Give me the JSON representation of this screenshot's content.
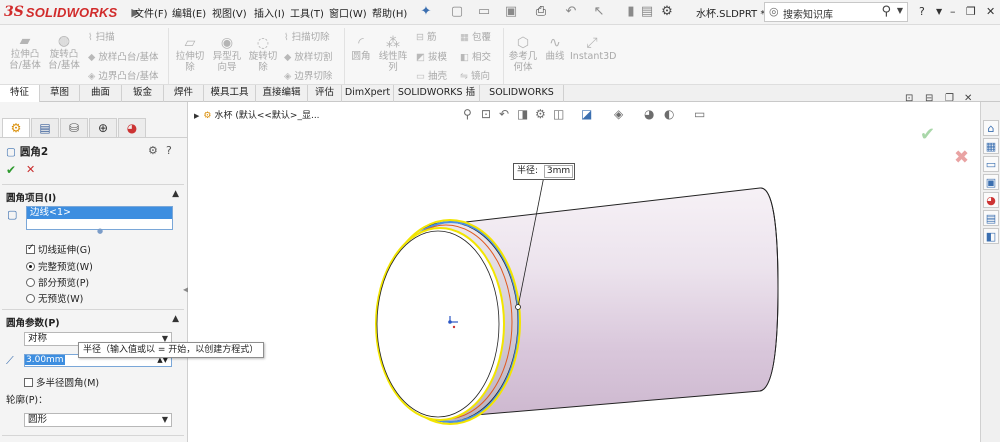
{
  "app": {
    "logo_text": "SOLIDWORKS",
    "menu": [
      "文件(F)",
      "编辑(E)",
      "视图(V)",
      "插入(I)",
      "工具(T)",
      "窗口(W)",
      "帮助(H)"
    ],
    "document_title": "水杯.SLDPRT *",
    "search_placeholder": "搜索知识库"
  },
  "ribbon": {
    "extrude_boss": [
      "拉伸凸",
      "台/基体"
    ],
    "revolve_boss": [
      "旋转凸",
      "台/基体"
    ],
    "sweep": "扫描",
    "loft": "放样凸台/基体",
    "boundary": "边界凸台/基体",
    "extrude_cut": [
      "拉伸切",
      "除"
    ],
    "hole_wizard": [
      "异型孔",
      "向导"
    ],
    "revolve_cut": [
      "旋转切",
      "除"
    ],
    "swept_cut": "扫描切除",
    "lofted_cut": "放样切割",
    "boundary_cut": "边界切除",
    "fillet": "圆角",
    "linear_pattern": [
      "线性阵",
      "列"
    ],
    "rib": "筋",
    "draft": "拔模",
    "shell": "抽壳",
    "wrap": "包覆",
    "intersect": "相交",
    "mirror": "镜向",
    "reference_geometry": [
      "参考几",
      "何体"
    ],
    "curves": "曲线",
    "instant3d": "Instant3D"
  },
  "tabs": [
    "特征",
    "草图",
    "曲面",
    "钣金",
    "焊件",
    "模具工具",
    "直接编辑",
    "评估",
    "DimXpert",
    "SOLIDWORKS 插件",
    "SOLIDWORKS MBD"
  ],
  "active_tab": "特征",
  "property_manager": {
    "title": "圆角2",
    "section_items": "圆角项目(I)",
    "edge_item": "边线<1>",
    "tangent_propagation": "切线延伸(G)",
    "tangent_propagation_checked": true,
    "preview_full": "完整预览(W)",
    "preview_partial": "部分预览(P)",
    "preview_none": "无预览(W)",
    "preview_selected": "full",
    "section_params": "圆角参数(P)",
    "symmetry": "对称",
    "radius_value": "3.00mm",
    "multi_radius": "多半径圆角(M)",
    "multi_radius_checked": false,
    "profile_label": "轮廓(P)：",
    "profile_value": "圆形",
    "tooltip": "半径（输入值或以 = 开始，以创建方程式）"
  },
  "graphics": {
    "breadcrumb": "水杯 (默认<<默认>_显...",
    "callout_label": "半径:",
    "callout_value": "3mm"
  }
}
